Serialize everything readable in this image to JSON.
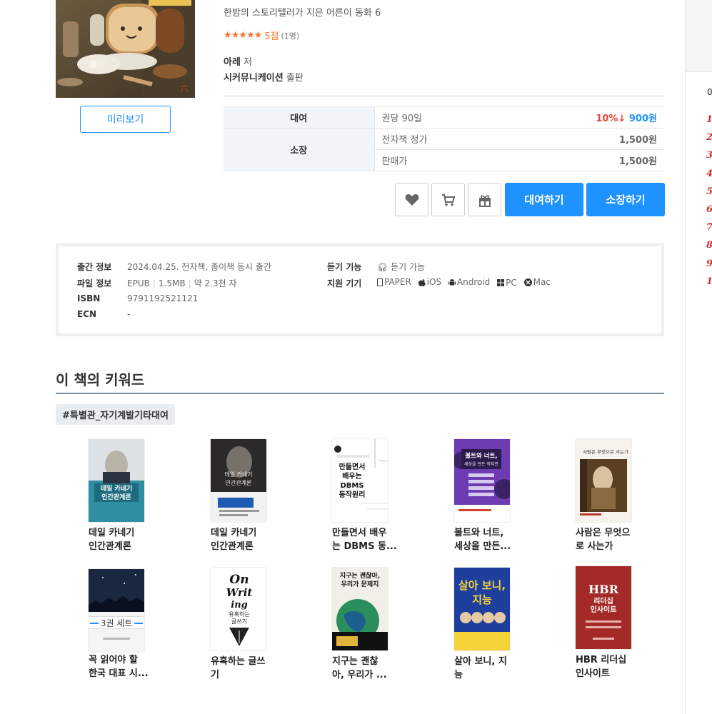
{
  "book": {
    "subtitle": "한밤의 스토리텔러가 지은 어른이 동화 6",
    "rating_stars": "★★★★★",
    "rating_score": "5점",
    "rating_count": "(1명)",
    "author_name": "아레",
    "author_suffix": " 저",
    "publisher_name": "시커뮤니케이션",
    "publisher_suffix": " 출판",
    "preview_label": "미리보기"
  },
  "price": {
    "rent_label": "대여",
    "rent_key": "권당 90일",
    "rent_discount": "10%↓",
    "rent_price": "900원",
    "own_label": "소장",
    "ebook_price_key": "전자책 정가",
    "ebook_price_value": "1,500원",
    "sale_price_key": "판매가",
    "sale_price_value": "1,500원"
  },
  "actions": {
    "rent_button": "대여하기",
    "buy_button": "소장하기"
  },
  "info": {
    "release_key": "출간 정보",
    "release_value": "2024.04.25. 전자책, 종이책 동시 출간",
    "file_key": "파일 정보",
    "file_format": "EPUB",
    "file_size": "1.5MB",
    "file_length": "약 2.3천 자",
    "isbn_key": "ISBN",
    "isbn_value": "9791192521121",
    "ecn_key": "ECN",
    "ecn_value": "-",
    "listen_key": "듣기 기능",
    "listen_value": "듣기 가능",
    "devices_key": "지원 기기",
    "devices": [
      "PAPER",
      "iOS",
      "Android",
      "PC",
      "Mac"
    ]
  },
  "keywords": {
    "title": "이 책의 키워드",
    "tag": "#특별관_자기계발기타대여"
  },
  "books": [
    {
      "title1": "데일 카네기",
      "title2": "인간관계론",
      "cover_text": "데일 카네기\n인간관계론"
    },
    {
      "title1": "데일 카네기",
      "title2": "인간관계론",
      "cover_text": "데일 카네기\n인간관계론"
    },
    {
      "title1": "만들면서 배우",
      "title2": "는 DBMS 동...",
      "cover_text": "만들면서\n배우는\nDBMS\n동작원리"
    },
    {
      "title1": "볼트와 너트,",
      "title2": "세상을 만든...",
      "cover_text": "볼트와 너트,\n세상을 만든 작지만\n위대한 것들의 과학"
    },
    {
      "title1": "사람은 무엇으",
      "title2": "로 사는가",
      "cover_text": "사람은 무엇으로 사는가"
    },
    {
      "title1": "꼭 읽어야 할",
      "title2": "한국 대표 시...",
      "cover_text": "3권 세트"
    },
    {
      "title1": "유혹하는 글쓰",
      "title2": "기",
      "cover_text": "On Writing\n유혹하는\n글쓰기"
    },
    {
      "title1": "지구는 괜찮",
      "title2": "아, 우리가 ...",
      "cover_text": "지구는 괜찮아,\n우리가 문제지"
    },
    {
      "title1": "살아 보니, 지",
      "title2": "능",
      "cover_text": "살아 보니,\n지능"
    },
    {
      "title1": "HBR 리더십",
      "title2": "인사이트",
      "cover_text": "HBR\n리더십\n인사이트"
    }
  ],
  "side": {
    "heading_partial": "0",
    "ranks": [
      "1",
      "2",
      "3",
      "4",
      "5",
      "6",
      "7",
      "8",
      "9",
      "1"
    ]
  }
}
